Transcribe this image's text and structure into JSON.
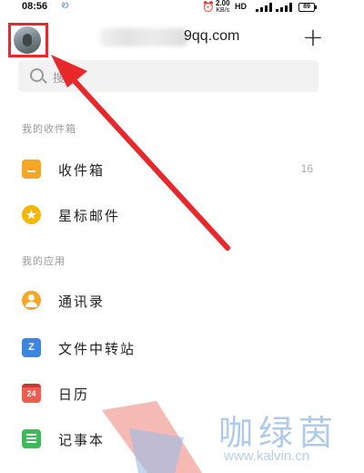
{
  "status_bar": {
    "time": "08:56",
    "glyph": "Ꮼ",
    "speed_value": "2.00",
    "speed_unit": "KB/s",
    "network": "HD",
    "battery": "89"
  },
  "header": {
    "account_suffix": "9qq.com",
    "add_label": "+"
  },
  "search": {
    "placeholder": "搜索"
  },
  "mailboxes": {
    "section_title": "我的收件箱",
    "items": [
      {
        "label": "收件箱",
        "count": "16",
        "icon": "inbox-icon"
      },
      {
        "label": "星标邮件",
        "count": "",
        "icon": "star-icon"
      }
    ]
  },
  "apps": {
    "section_title": "我的应用",
    "items": [
      {
        "label": "通讯录",
        "icon": "contacts-icon",
        "icon_text": ""
      },
      {
        "label": "文件中转站",
        "icon": "file-transfer-icon",
        "icon_text": "Z"
      },
      {
        "label": "日历",
        "icon": "calendar-icon",
        "icon_text": "24"
      },
      {
        "label": "记事本",
        "icon": "notes-icon",
        "icon_text": ""
      }
    ]
  },
  "watermark": {
    "title": "咖绿茵",
    "url": "www.kalvin.cn"
  },
  "colors": {
    "highlight": "#e8282b",
    "inbox": "#f5a623",
    "star": "#f5b800",
    "contacts": "#f5a623",
    "transfer": "#3b86e0",
    "calendar": "#f05c4f",
    "notes": "#3dbb5c",
    "watermark": "#9bbde8"
  }
}
